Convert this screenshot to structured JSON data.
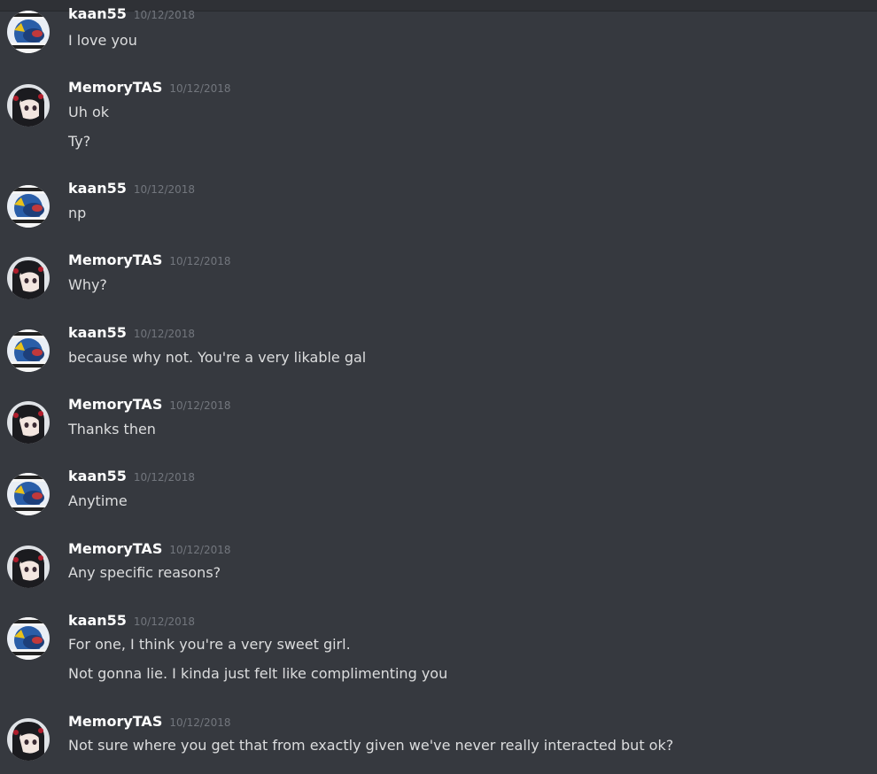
{
  "colors": {
    "background": "#36393f",
    "username": "#ffffff",
    "message_text": "#dcddde",
    "timestamp": "#72767d"
  },
  "messages": [
    {
      "author": "kaan55",
      "timestamp": "10/12/2018",
      "avatar": "kaan55-avatar",
      "lines": [
        "I love you"
      ]
    },
    {
      "author": "MemoryTAS",
      "timestamp": "10/12/2018",
      "avatar": "memorytas-avatar",
      "lines": [
        "Uh ok",
        "Ty?"
      ]
    },
    {
      "author": "kaan55",
      "timestamp": "10/12/2018",
      "avatar": "kaan55-avatar",
      "lines": [
        "np"
      ]
    },
    {
      "author": "MemoryTAS",
      "timestamp": "10/12/2018",
      "avatar": "memorytas-avatar",
      "lines": [
        "Why?"
      ]
    },
    {
      "author": "kaan55",
      "timestamp": "10/12/2018",
      "avatar": "kaan55-avatar",
      "lines": [
        "because why not. You're a very likable gal"
      ]
    },
    {
      "author": "MemoryTAS",
      "timestamp": "10/12/2018",
      "avatar": "memorytas-avatar",
      "lines": [
        "Thanks then"
      ]
    },
    {
      "author": "kaan55",
      "timestamp": "10/12/2018",
      "avatar": "kaan55-avatar",
      "lines": [
        "Anytime"
      ]
    },
    {
      "author": "MemoryTAS",
      "timestamp": "10/12/2018",
      "avatar": "memorytas-avatar",
      "lines": [
        "Any specific reasons?"
      ]
    },
    {
      "author": "kaan55",
      "timestamp": "10/12/2018",
      "avatar": "kaan55-avatar",
      "lines": [
        "For one, I think you're a very sweet girl.",
        "Not gonna lie. I kinda just felt like complimenting you"
      ]
    },
    {
      "author": "MemoryTAS",
      "timestamp": "10/12/2018",
      "avatar": "memorytas-avatar",
      "lines": [
        "Not sure where you get that from exactly given we've never really interacted but ok?"
      ]
    }
  ]
}
